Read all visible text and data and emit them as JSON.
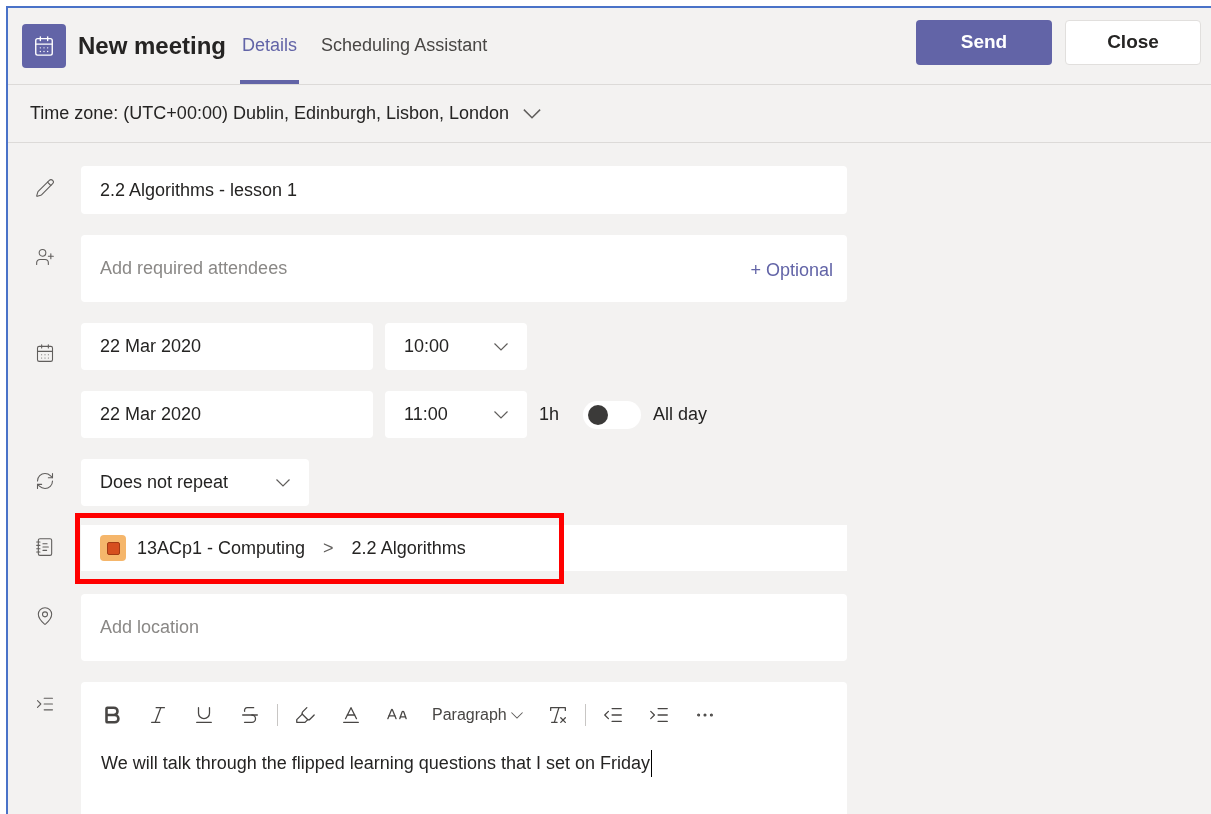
{
  "header": {
    "title": "New meeting",
    "tabs": [
      {
        "label": "Details",
        "selected": true
      },
      {
        "label": "Scheduling Assistant",
        "selected": false
      }
    ],
    "buttons": [
      {
        "label": "Send",
        "kind": "primary"
      },
      {
        "label": "Close",
        "kind": "secondary"
      }
    ]
  },
  "time_zone": {
    "label": "Time zone: (UTC+00:00) Dublin, Edinburgh, Lisbon, London"
  },
  "form": {
    "title": {
      "value": "2.2 Algorithms - lesson 1"
    },
    "attendees": {
      "placeholder": "Add required attendees",
      "optional_link": "+ Optional"
    },
    "start": {
      "date": "22 Mar 2020",
      "time": "10:00"
    },
    "end": {
      "date": "22 Mar 2020",
      "time": "11:00",
      "duration": "1h",
      "all_day": {
        "label": "All day",
        "on": false
      }
    },
    "repeat": {
      "value": "Does not repeat"
    },
    "channel": {
      "team": "13ACp1 - Computing",
      "separator": ">",
      "channel": "2.2 Algorithms",
      "highlighted": true
    },
    "location": {
      "placeholder": "Add location"
    },
    "editor": {
      "format": "Paragraph",
      "body": "We will talk through the flipped learning questions that I set on Friday"
    }
  }
}
